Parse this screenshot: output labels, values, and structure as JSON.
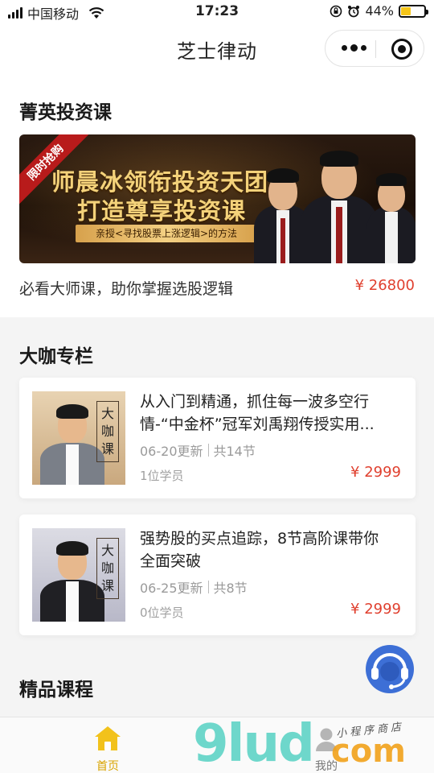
{
  "status_bar": {
    "carrier": "中国移动",
    "time": "17:23",
    "battery": "44%",
    "battery_level": 0.44
  },
  "nav": {
    "title": "芝士律动"
  },
  "elite_course": {
    "section_title": "菁英投资课",
    "banner": {
      "ribbon": "限时抢购",
      "line1": "师晨冰领衔投资天团",
      "line2": "打造尊享投资课",
      "strip": "亲授<寻找股票上涨逻辑>的方法"
    },
    "description": "必看大师课，助你掌握选股逻辑",
    "price": "¥ 26800"
  },
  "columns": {
    "section_title": "大咖专栏",
    "badge": "大咖课",
    "cards": [
      {
        "title_line1": "从入门到精通，抓住每一波多空行",
        "title_line2": "情-“中金杯”冠军刘禹翔传授实用...",
        "update": "06-20更新",
        "lessons": "共14节",
        "students": "1位学员",
        "price": "¥ 2999"
      },
      {
        "title_line1": "强势股的买点追踪，8节高阶课带你",
        "title_line2": "全面突破",
        "update": "06-25更新",
        "lessons": "共8节",
        "students": "0位学员",
        "price": "¥ 2999"
      }
    ]
  },
  "premium": {
    "section_title": "精品课程"
  },
  "tab_bar": {
    "home": "首页",
    "mine": "我的",
    "active_color": "#d9a400"
  },
  "watermark": {
    "brand": "9lud",
    "suffix": "com",
    "tagline": "小程序商店"
  }
}
